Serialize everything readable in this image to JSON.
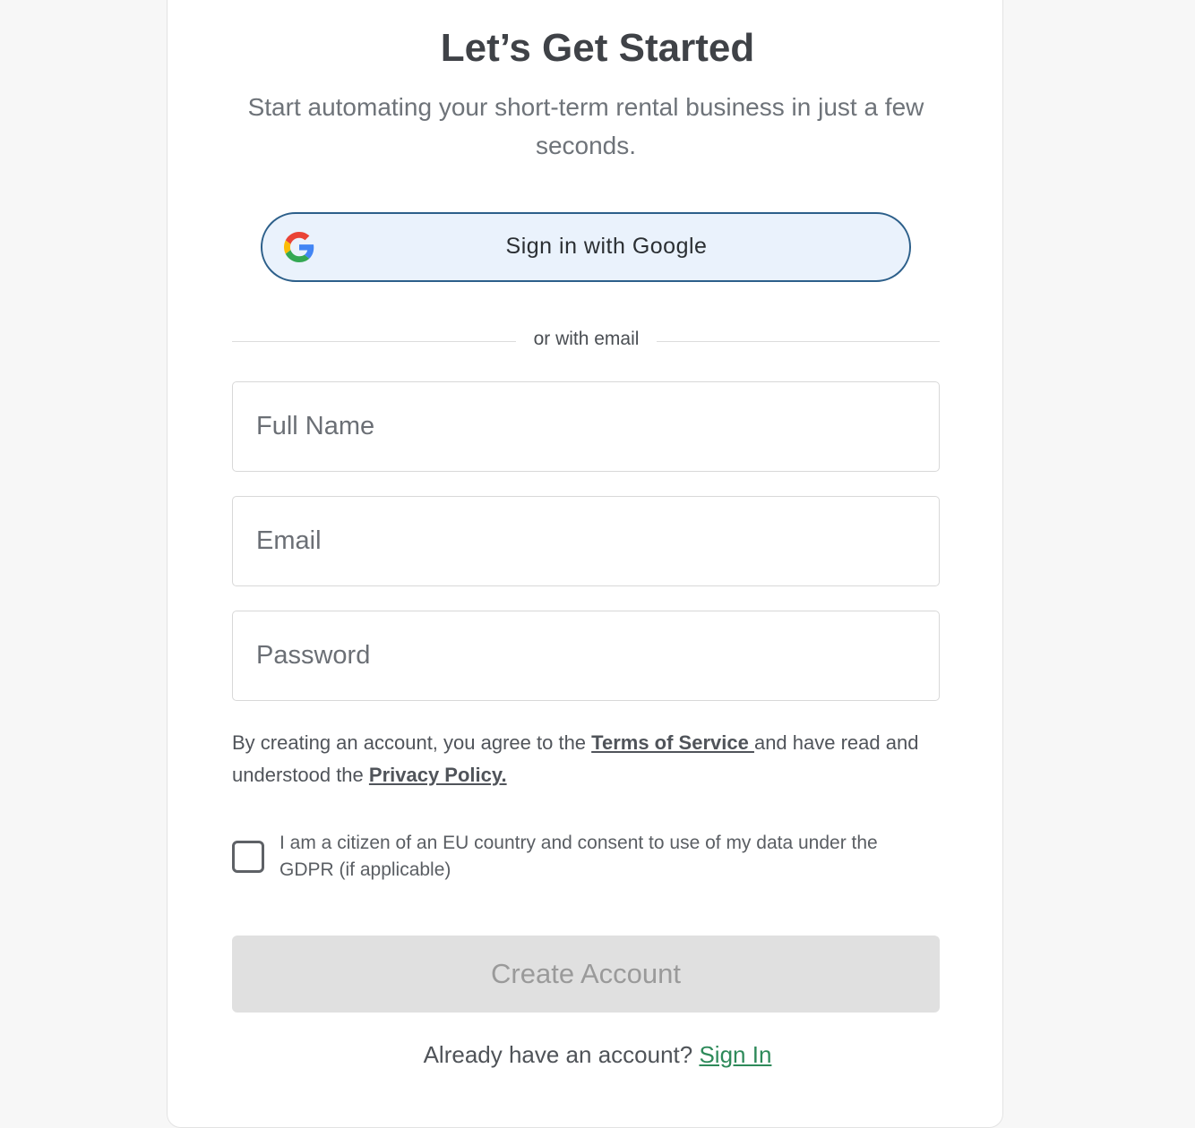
{
  "header": {
    "title": "Let’s Get Started",
    "subtitle": "Start automating your short-term rental business in just a few seconds."
  },
  "google_button": {
    "label": "Sign in with Google",
    "icon": "google-g-icon"
  },
  "divider": {
    "text": "or with email"
  },
  "form": {
    "full_name_placeholder": "Full Name",
    "full_name_value": "",
    "email_placeholder": "Email",
    "email_value": "",
    "password_placeholder": "Password",
    "password_value": ""
  },
  "terms": {
    "prefix": "By creating an account, you agree to the ",
    "terms_link": "Terms of Service ",
    "middle": "and have read and understood the ",
    "privacy_link": "Privacy Policy."
  },
  "gdpr": {
    "checked": false,
    "label": "I am a citizen of an EU country and consent to use of my data under the GDPR (if applicable)"
  },
  "submit": {
    "label": "Create Account",
    "enabled": false
  },
  "footer": {
    "prompt": "Already have an account? ",
    "signin_link": "Sign In"
  },
  "colors": {
    "google_button_border": "#2c5f8a",
    "google_button_bg": "#eaf2fc",
    "signin_link": "#2e8a5a",
    "create_button_bg": "#e0e0e0",
    "create_button_text": "#9a9a9a"
  }
}
